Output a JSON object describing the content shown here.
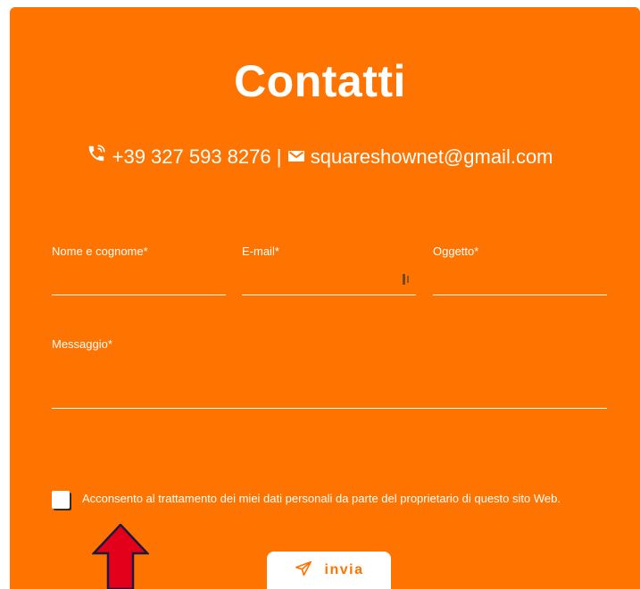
{
  "colors": {
    "accent": "#ff7300",
    "text": "#ffffff",
    "arrow": "#e3001b"
  },
  "title": "Contatti",
  "contact": {
    "phone": "+39 327 593 8276",
    "separator": "|",
    "email": "squareshownet@gmail.com",
    "phone_icon": "phone-icon",
    "email_icon": "envelope-icon"
  },
  "form": {
    "name_label": "Nome e cognome*",
    "email_label": "E-mail*",
    "subject_label": "Oggetto*",
    "message_label": "Messaggio*",
    "name_value": "",
    "email_value": "",
    "subject_value": "",
    "message_value": ""
  },
  "consent": {
    "checked": false,
    "text": "Acconsento al trattamento dei miei dati personali da parte del proprietario di questo sito Web."
  },
  "send_button": {
    "label": "invia",
    "icon": "send-icon"
  }
}
